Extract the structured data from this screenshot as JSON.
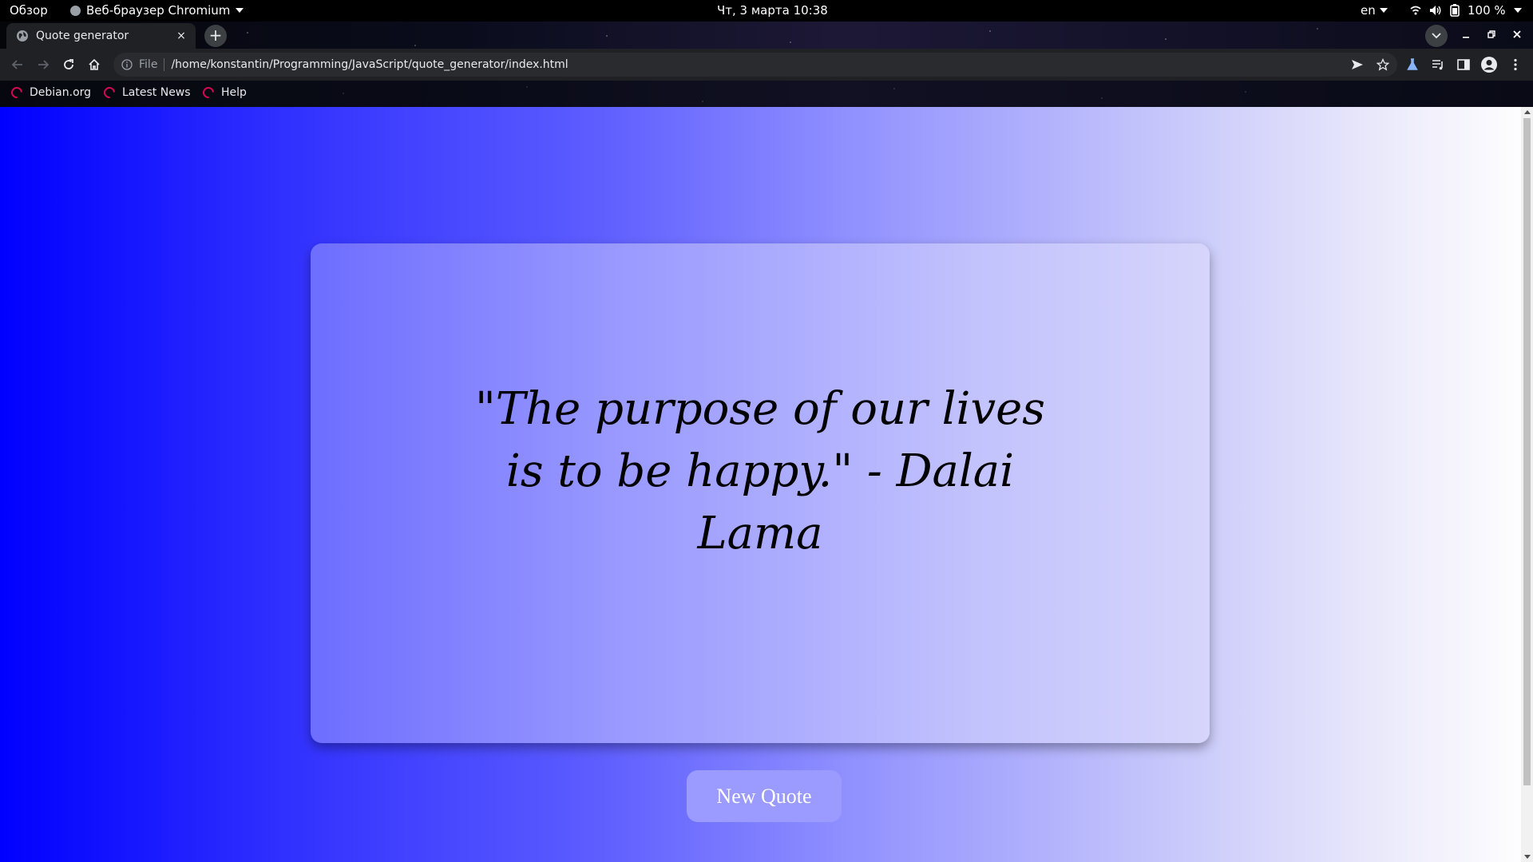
{
  "system_bar": {
    "overview": "Обзор",
    "app_menu": "Веб-браузер Chromium",
    "clock": "Чт, 3 марта  10:38",
    "language": "en",
    "battery": "100 %"
  },
  "browser": {
    "tab_title": "Quote generator",
    "tab_close": "×",
    "new_tab": "+",
    "url_scheme": "File",
    "url": "/home/konstantin/Programming/JavaScript/quote_generator/index.html",
    "bookmarks": [
      {
        "label": "Debian.org"
      },
      {
        "label": "Latest News"
      },
      {
        "label": "Help"
      }
    ]
  },
  "page": {
    "quote": "\"The purpose of our lives is to be happy.\" - Dalai Lama",
    "button_label": "New Quote"
  },
  "colors": {
    "gradient_start": "#0000ff",
    "gradient_end": "#ffffff",
    "button_bg": "#9b9bff"
  }
}
